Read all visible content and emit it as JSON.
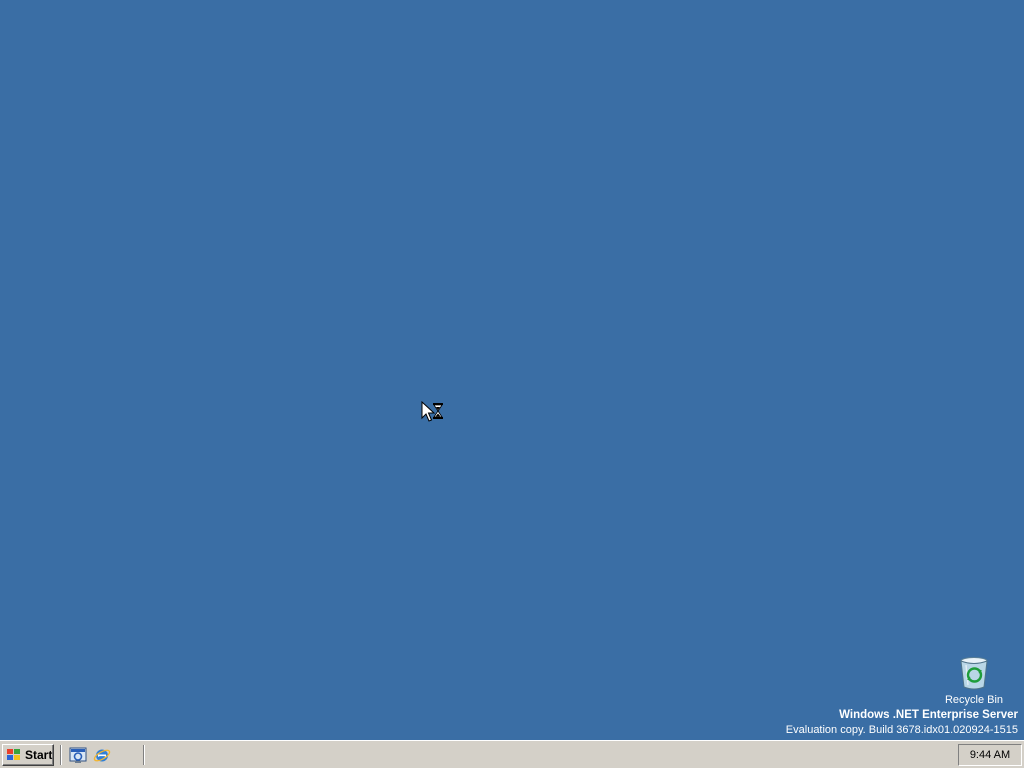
{
  "desktop": {
    "background_color": "#3a6ea5",
    "icons": [
      {
        "label": "Recycle Bin",
        "icon": "recycle-bin-icon"
      }
    ],
    "watermark": {
      "title": "Windows .NET Enterprise Server",
      "build": "Evaluation copy. Build 3678.idx01.020924-1515"
    },
    "cursor": {
      "icon": "busy-cursor-icon"
    }
  },
  "taskbar": {
    "start_label": "Start",
    "quick_launch": [
      {
        "icon": "show-desktop-icon"
      },
      {
        "icon": "internet-explorer-icon"
      }
    ],
    "clock": "9:44 AM"
  }
}
